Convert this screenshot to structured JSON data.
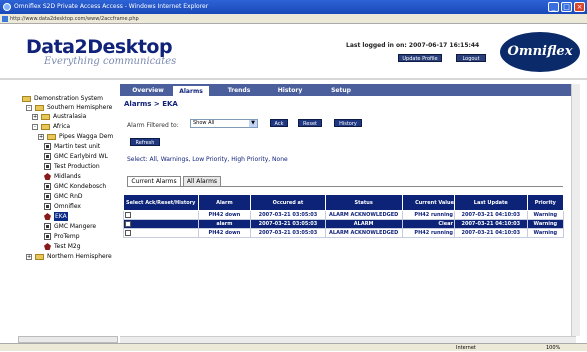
{
  "window": {
    "title": "Omniflex S2D Private Access Access - Windows Internet Explorer",
    "address": "http://www.data2desktop.com/www/2accframe.php"
  },
  "header": {
    "logo": "Data2Desktop",
    "tagline": "Everything communicates",
    "last_logged_label": "Last logged in on: 2007-06-17 16:15:44",
    "update_profile": "Update Profile",
    "logout": "Logout",
    "brand": "Omniflex"
  },
  "sidebar": {
    "items": [
      {
        "label": "Demonstration System",
        "type": "folder"
      },
      {
        "label": "Southern Hemisphere",
        "type": "folder"
      },
      {
        "label": "Australasia",
        "type": "folder"
      },
      {
        "label": "Africa",
        "type": "folder"
      },
      {
        "label": "Pipes Wagga Dem",
        "type": "folder"
      },
      {
        "label": "Martin test unit",
        "type": "node"
      },
      {
        "label": "GMC Earlybird WL",
        "type": "node"
      },
      {
        "label": "Test Production",
        "type": "node"
      },
      {
        "label": "Midlands",
        "type": "alarm"
      },
      {
        "label": "GMC Kondebosch",
        "type": "node"
      },
      {
        "label": "GMC RnD",
        "type": "node"
      },
      {
        "label": "Omniflex",
        "type": "node"
      },
      {
        "label": "EKA",
        "type": "alarm"
      },
      {
        "label": "GMC Mangere",
        "type": "node"
      },
      {
        "label": "ProTemp",
        "type": "node"
      },
      {
        "label": "Test M2g",
        "type": "alarm"
      },
      {
        "label": "Northern Hemisphere",
        "type": "folder"
      }
    ]
  },
  "tabs": [
    "Overview",
    "Alarms",
    "Trends",
    "History",
    "Setup"
  ],
  "breadcrumb": "Alarms > EKA",
  "filter": {
    "label": "Alarm Filtered to:",
    "value": "Show All",
    "ack": "Ack",
    "reset": "Reset",
    "history": "History",
    "refresh": "Refresh"
  },
  "select_links": "Select: All, Warnings, Low Priority, High Priority, None",
  "subtabs": [
    "Current Alarms",
    "All Alarms"
  ],
  "table": {
    "headers": [
      "Select Ack/Reset/History",
      "Alarm",
      "Occured at",
      "Status",
      "Current Value",
      "Last Update",
      "Priority"
    ],
    "rows": [
      [
        "",
        "PH42 down",
        "2007-03-21 03:05:03",
        "ALARM ACKNOWLEDGED",
        "PH42 running",
        "2007-03-21 04:10:03",
        "Warning"
      ],
      [
        "",
        "alarm",
        "2007-03-21 03:05:03",
        "ALARM",
        "Clear",
        "2007-03-21 04:10:03",
        "Warning"
      ],
      [
        "",
        "PH42 down",
        "2007-03-21 03:05:03",
        "ALARM ACKNOWLEDGED",
        "PH42 running",
        "2007-03-21 04:10:03",
        "Warning"
      ]
    ]
  },
  "statusbar": {
    "zone": "Internet",
    "zoom": "100%"
  }
}
